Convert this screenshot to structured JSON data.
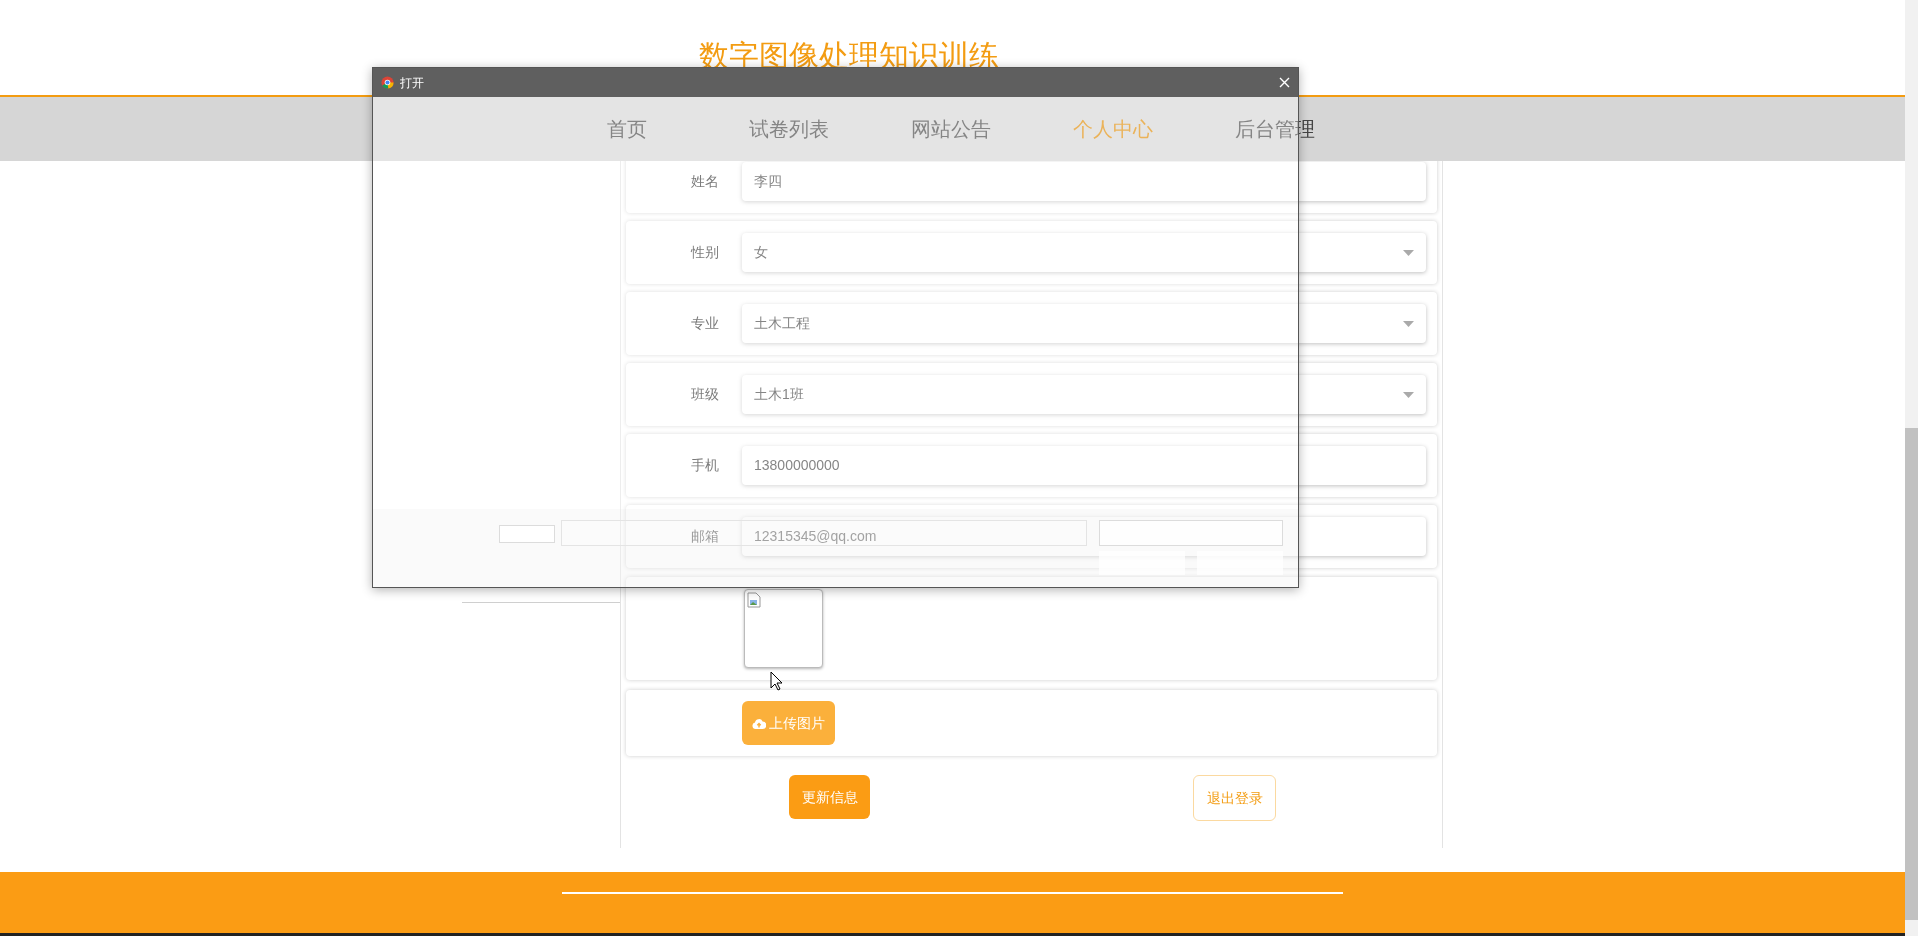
{
  "site_title": "数字图像处理知识训练",
  "nav": [
    {
      "label": "首页",
      "selected": false
    },
    {
      "label": "试卷列表",
      "selected": false
    },
    {
      "label": "网站公告",
      "selected": false
    },
    {
      "label": "个人中心",
      "selected": true
    },
    {
      "label": "后台管理",
      "selected": false
    }
  ],
  "form": {
    "fields": [
      {
        "label": "姓名",
        "value": "李四",
        "kind": "text"
      },
      {
        "label": "性别",
        "value": "女",
        "kind": "select"
      },
      {
        "label": "专业",
        "value": "土木工程",
        "kind": "select"
      },
      {
        "label": "班级",
        "value": "土木1班",
        "kind": "select"
      },
      {
        "label": "手机",
        "value": "13800000000",
        "kind": "text"
      },
      {
        "label": "邮箱",
        "value": "12315345@qq.com",
        "kind": "text"
      }
    ],
    "upload_button": "上传图片"
  },
  "actions": [
    {
      "label": "更新信息",
      "kind": "primary"
    },
    {
      "label": "退出登录",
      "kind": "outline"
    }
  ],
  "dialog": {
    "title": "打开"
  }
}
